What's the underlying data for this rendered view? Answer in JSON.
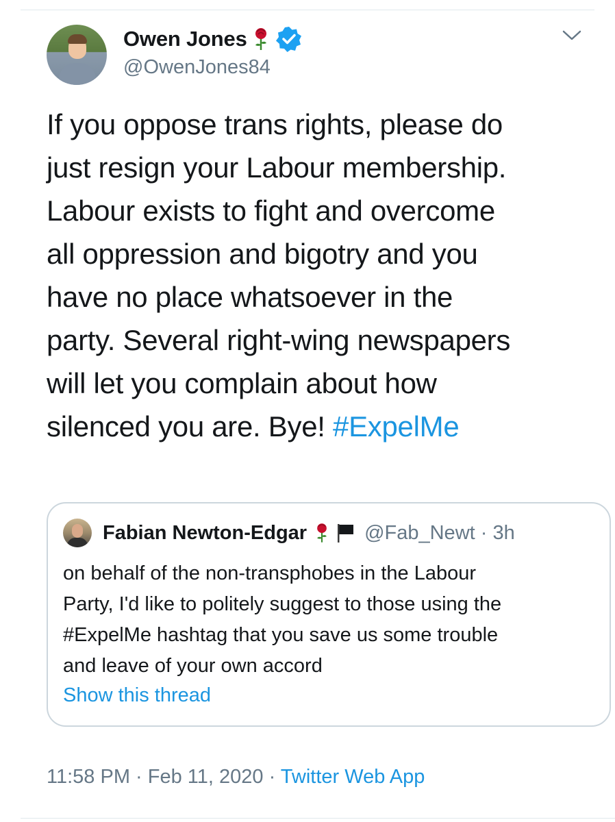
{
  "tweet": {
    "author_name": "Owen Jones",
    "author_handle": "@OwenJones84",
    "text_lines": [
      "If you oppose trans rights, please do",
      "just resign your Labour membership.",
      "Labour exists to fight and overcome",
      "all oppression and bigotry and you",
      "have no place whatsoever in the",
      "party. Several right-wing newspapers",
      "will let you complain about how"
    ],
    "text_last_line": "silenced you are. Bye! ",
    "hashtag": "#ExpelMe",
    "time": "11:58 PM",
    "date": "Feb 11, 2020",
    "source": "Twitter Web App",
    "separator": " · "
  },
  "quoted": {
    "author_name": "Fabian Newton-Edgar",
    "author_handle": "@Fab_Newt · 3h",
    "text": "on behalf of the non-transphobes in the Labour\nParty, I'd like to politely suggest to those using the\n#ExpelMe hashtag that you save us some trouble\nand leave of your own accord",
    "show_thread": "Show this thread"
  },
  "icons": {
    "rose": "red-rose-icon",
    "verified": "verified-badge-icon",
    "flag": "black-flag-icon",
    "chevron": "chevron-down-icon"
  },
  "colors": {
    "link": "#1b95e0",
    "secondary_text": "#657786",
    "verified": "#1da1f2",
    "rose": "#c8102e",
    "border": "#ccd6dd"
  }
}
